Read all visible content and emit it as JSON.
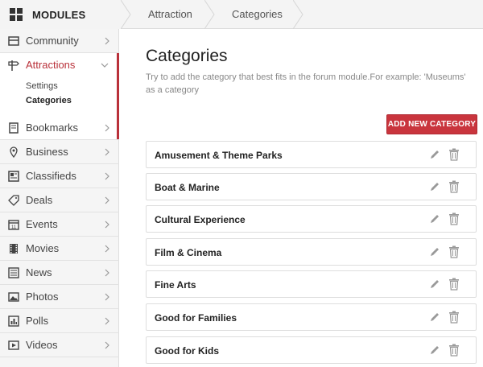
{
  "header": {
    "modules_label": "MODULES",
    "breadcrumb": [
      "Attraction",
      "Categories"
    ]
  },
  "sidebar": {
    "items": [
      {
        "label": "Community",
        "icon": "community-icon"
      },
      {
        "label": "Attractions",
        "icon": "signpost-icon",
        "active": true,
        "subitems": [
          "Settings",
          "Categories"
        ]
      },
      {
        "label": "Bookmarks",
        "icon": "bookmark-icon"
      },
      {
        "label": "Business",
        "icon": "map-pin-icon"
      },
      {
        "label": "Classifieds",
        "icon": "classifieds-icon"
      },
      {
        "label": "Deals",
        "icon": "tag-icon"
      },
      {
        "label": "Events",
        "icon": "calendar-icon"
      },
      {
        "label": "Movies",
        "icon": "film-icon"
      },
      {
        "label": "News",
        "icon": "newspaper-icon"
      },
      {
        "label": "Photos",
        "icon": "photo-icon"
      },
      {
        "label": "Polls",
        "icon": "poll-icon"
      },
      {
        "label": "Videos",
        "icon": "video-icon"
      }
    ]
  },
  "main": {
    "title": "Categories",
    "description": "Try to add the category that best fits in the forum module.For example: 'Museums' as a category",
    "add_button": "ADD NEW CATEGORY",
    "categories": [
      "Amusement & Theme Parks",
      "Boat & Marine",
      "Cultural Experience",
      "Film & Cinema",
      "Fine Arts",
      "Good for Families",
      "Good for Kids"
    ]
  },
  "colors": {
    "accent": "#b9313a",
    "button": "#c9353d"
  }
}
